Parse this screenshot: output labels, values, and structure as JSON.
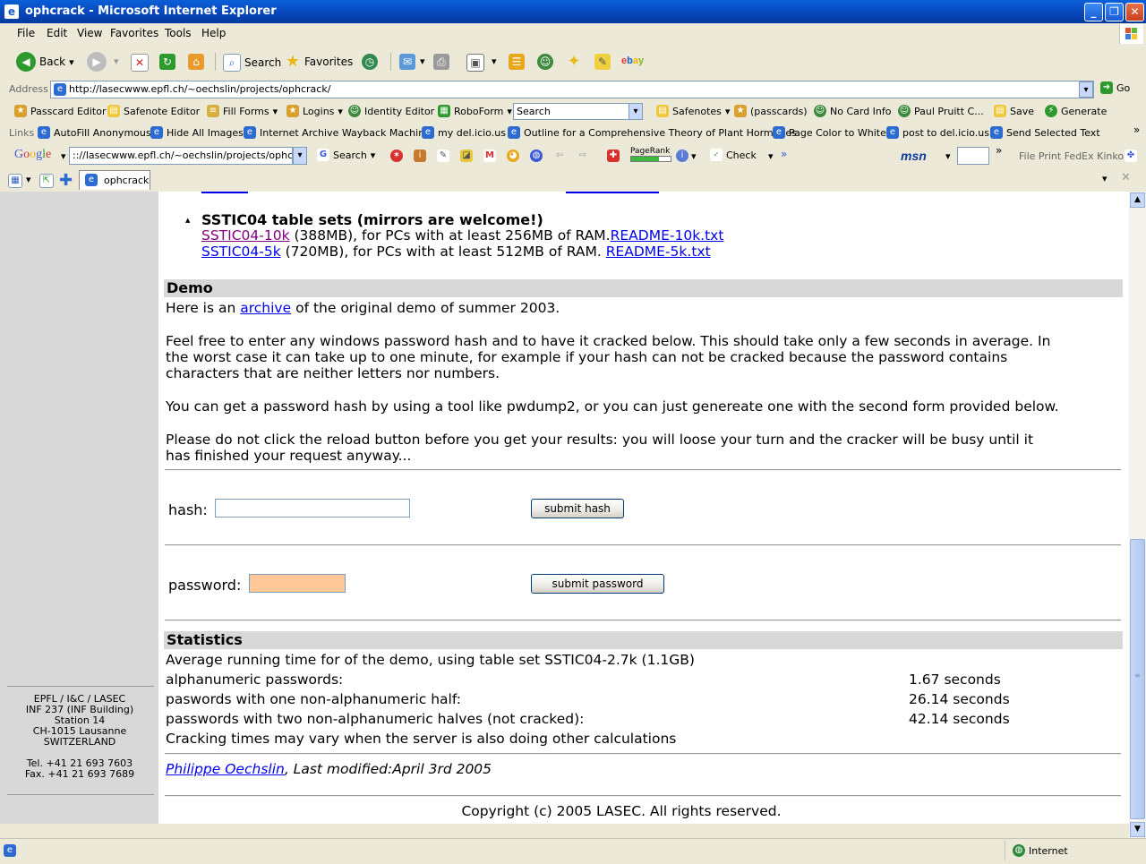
{
  "window": {
    "title": "ophcrack - Microsoft Internet Explorer"
  },
  "menu": [
    "File",
    "Edit",
    "View",
    "Favorites",
    "Tools",
    "Help"
  ],
  "toolbar": {
    "back": "Back",
    "search": "Search",
    "favorites": "Favorites"
  },
  "address": {
    "label": "Address",
    "url": "http://lasecwww.epfl.ch/~oechslin/projects/ophcrack/",
    "go": "Go"
  },
  "roboform": {
    "passcard_editor": "Passcard Editor",
    "safenote_editor": "Safenote Editor",
    "fill_forms": "Fill Forms",
    "logins": "Logins",
    "identity_editor": "Identity Editor",
    "roboform": "RoboForm",
    "search_value": "Search",
    "safenotes": "Safenotes",
    "passcards": "(passcards)",
    "no_card_info": "No Card Info",
    "paul": "Paul Pruitt C...",
    "save": "Save",
    "generate": "Generate"
  },
  "links": {
    "label": "Links",
    "items": [
      "AutoFill Anonymous",
      "Hide All Images",
      "Internet Archive Wayback Machine",
      "my del.icio.us",
      "Outline for a Comprehensive Theory of Plant Hormones",
      "Page Color to White",
      "post to del.icio.us",
      "Send Selected Text"
    ]
  },
  "google": {
    "label": "Google",
    "url": ":://lasecwww.epfl.ch/~oechslin/projects/ophcrack/",
    "search": "Search",
    "pagerank": "PageRank",
    "check": "Check",
    "msn": "msn",
    "fedex": "File Print FedEx Kinko's"
  },
  "tab": {
    "label": "ophcrack"
  },
  "sidebar": {
    "address_lines": [
      "EPFL / I&C / LASEC",
      "INF 237 (INF Building)",
      "Station 14",
      "CH-1015 Lausanne",
      "SWITZERLAND"
    ],
    "tel": "Tel. +41 21 693 7603",
    "fax": "Fax. +41 21 693 7689"
  },
  "page": {
    "sstic_title": "SSTIC04 table sets (mirrors are welcome!)",
    "sstic10k": {
      "link": "SSTIC04-10k",
      "text": " (388MB), for PCs with at least 256MB of RAM.",
      "readme": "README-10k.txt"
    },
    "sstic5k": {
      "link": "SSTIC04-5k",
      "text": " (720MB), for PCs with at least 512MB of RAM. ",
      "readme": "README-5k.txt"
    },
    "demo_heading": "Demo",
    "demo_p1_a": "Here is an ",
    "demo_p1_link": "archive",
    "demo_p1_b": " of the original demo of summer 2003.",
    "demo_p2": [
      "Feel free to enter any windows password hash and to have it cracked below. This should take only a few seconds in average. In",
      "the worst case it can take up to one minute, for example if your hash can not be cracked because the password contains",
      "characters that are neither letters nor numbers."
    ],
    "demo_p3": "You can get a password hash by using a tool like pwdump2, or you can just genereate one with the second form provided below.",
    "demo_p4": [
      "Please do not click the reload button before you get your results: you will loose your turn and the cracker will be busy until it",
      "has finished your request anyway..."
    ],
    "hash_label": "hash:",
    "hash_value": "",
    "submit_hash": "submit hash",
    "password_label": "password:",
    "password_value": "",
    "submit_password": "submit password",
    "stats_heading": "Statistics",
    "stats_intro": "Average running time for of the demo, using table set SSTIC04-2.7k (1.1GB)",
    "stats": [
      {
        "label": "alphanumeric passwords:",
        "value": "1.67 seconds"
      },
      {
        "label": "paswords with one non-alphanumeric half:",
        "value": "26.14 seconds"
      },
      {
        "label": "passwords with two non-alphanumeric halves (not cracked):",
        "value": "42.14 seconds"
      }
    ],
    "stats_note": "Cracking times may vary when the server is also doing other calculations",
    "author": "Philippe Oechslin",
    "modified": ", Last modified:April 3rd 2005",
    "copyright": "Copyright (c) 2005 LASEC. All rights reserved."
  },
  "status": {
    "zone": "Internet"
  },
  "colors": {
    "titlebar": "#0845b8",
    "password_field_bg": "#ffc896",
    "section_bg": "#d8d8d8",
    "link": "#0000ee",
    "visited": "#800080"
  }
}
